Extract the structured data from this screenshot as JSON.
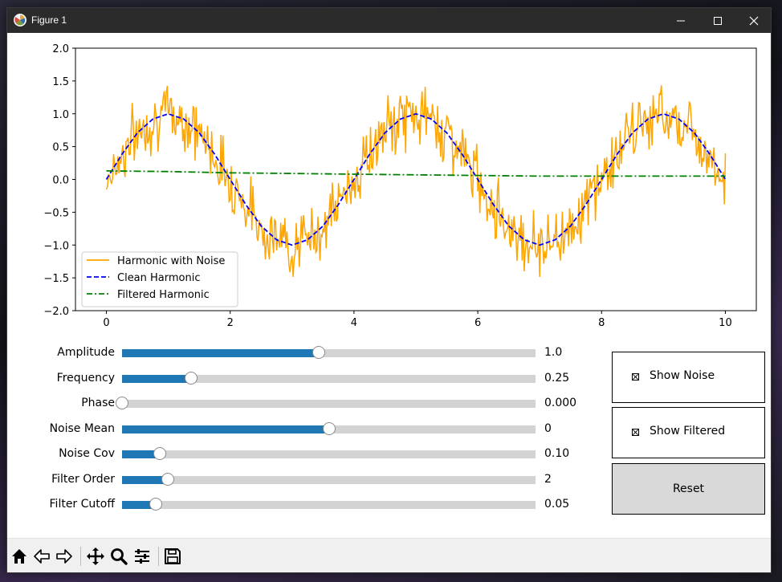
{
  "window": {
    "title": "Figure 1"
  },
  "chart_data": {
    "type": "line",
    "title": "",
    "xlabel": "",
    "ylabel": "",
    "xlim": [
      -0.5,
      10.5
    ],
    "ylim": [
      -2.0,
      2.0
    ],
    "x_ticks": [
      "0",
      "2",
      "4",
      "6",
      "8",
      "10"
    ],
    "y_ticks": [
      "2.0",
      "1.5",
      "1.0",
      "0.5",
      "0.0",
      "−0.5",
      "−1.0",
      "−1.5",
      "−2.0"
    ],
    "grid": false,
    "legend_position": "lower-left",
    "series": [
      {
        "name": "Harmonic with Noise",
        "style": "solid",
        "color": "#ffa500",
        "x": [
          0,
          0.25,
          0.5,
          0.75,
          1.0,
          1.25,
          1.5,
          1.75,
          2.0,
          2.25,
          2.5,
          2.75,
          3.0,
          3.25,
          3.5,
          3.75,
          4.0,
          4.25,
          4.5,
          4.75,
          5.0,
          5.25,
          5.5,
          5.75,
          6.0,
          6.25,
          6.5,
          6.75,
          7.0,
          7.25,
          7.5,
          7.75,
          8.0,
          8.25,
          8.5,
          8.75,
          9.0,
          9.25,
          9.5,
          9.75,
          10.0
        ],
        "y": [
          0.0,
          0.38,
          0.71,
          0.92,
          1.0,
          0.92,
          0.71,
          0.38,
          0.0,
          -0.38,
          -0.71,
          -0.92,
          -1.0,
          -0.92,
          -0.71,
          -0.38,
          0.0,
          0.38,
          0.71,
          0.92,
          1.0,
          0.92,
          0.71,
          0.38,
          0.0,
          -0.38,
          -0.71,
          -0.92,
          -1.0,
          -0.92,
          -0.71,
          -0.38,
          0.0,
          0.38,
          0.71,
          0.92,
          1.0,
          0.92,
          0.71,
          0.38,
          0.0
        ]
      },
      {
        "name": "Clean Harmonic",
        "style": "dashed",
        "color": "#0000ff",
        "x": [
          0,
          0.25,
          0.5,
          0.75,
          1.0,
          1.25,
          1.5,
          1.75,
          2.0,
          2.25,
          2.5,
          2.75,
          3.0,
          3.25,
          3.5,
          3.75,
          4.0,
          4.25,
          4.5,
          4.75,
          5.0,
          5.25,
          5.5,
          5.75,
          6.0,
          6.25,
          6.5,
          6.75,
          7.0,
          7.25,
          7.5,
          7.75,
          8.0,
          8.25,
          8.5,
          8.75,
          9.0,
          9.25,
          9.5,
          9.75,
          10.0
        ],
        "y": [
          0.0,
          0.38,
          0.71,
          0.92,
          1.0,
          0.92,
          0.71,
          0.38,
          0.0,
          -0.38,
          -0.71,
          -0.92,
          -1.0,
          -0.92,
          -0.71,
          -0.38,
          0.0,
          0.38,
          0.71,
          0.92,
          1.0,
          0.92,
          0.71,
          0.38,
          0.0,
          -0.38,
          -0.71,
          -0.92,
          -1.0,
          -0.92,
          -0.71,
          -0.38,
          0.0,
          0.38,
          0.71,
          0.92,
          1.0,
          0.92,
          0.71,
          0.38,
          0.0
        ]
      },
      {
        "name": "Filtered Harmonic",
        "style": "dashdot",
        "color": "#008000",
        "x": [
          0,
          1,
          2,
          3,
          4,
          5,
          6,
          7,
          8,
          9,
          10
        ],
        "y": [
          0.13,
          0.12,
          0.1,
          0.09,
          0.08,
          0.07,
          0.06,
          0.05,
          0.05,
          0.05,
          0.05
        ]
      }
    ]
  },
  "sliders": [
    {
      "label": "Amplitude",
      "value": "1.0",
      "fraction": 0.475
    },
    {
      "label": "Frequency",
      "value": "0.25",
      "fraction": 0.167
    },
    {
      "label": "Phase",
      "value": "0.000",
      "fraction": 0.0
    },
    {
      "label": "Noise Mean",
      "value": "0",
      "fraction": 0.5
    },
    {
      "label": "Noise Cov",
      "value": "0.10",
      "fraction": 0.091
    },
    {
      "label": "Filter Order",
      "value": "2",
      "fraction": 0.111
    },
    {
      "label": "Filter Cutoff",
      "value": "0.05",
      "fraction": 0.081
    }
  ],
  "checks": [
    {
      "label": "Show Noise",
      "checked": true
    },
    {
      "label": "Show Filtered",
      "checked": true
    }
  ],
  "reset_label": "Reset",
  "toolbar": {
    "icons": [
      "home-icon",
      "back-icon",
      "forward-icon",
      "pan-icon",
      "zoom-icon",
      "configure-icon",
      "save-icon"
    ]
  }
}
